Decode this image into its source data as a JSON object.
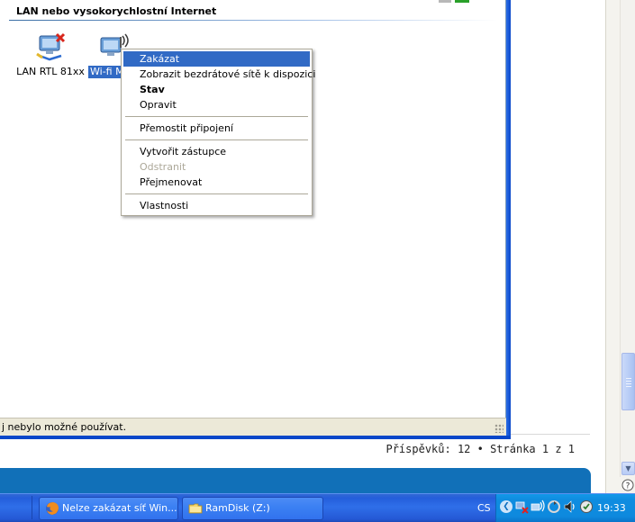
{
  "network_window": {
    "group_header": "LAN nebo vysokorychlostní Internet",
    "connections": [
      {
        "label": "LAN RTL 81xx",
        "icon": "network-disconnected-icon"
      },
      {
        "label": "Wi-fi Mi",
        "icon": "wireless-network-icon",
        "selected": true
      }
    ],
    "status_text": "j nebylo možné používat."
  },
  "context_menu": {
    "items": [
      {
        "label": "Zakázat",
        "state": "highlighted"
      },
      {
        "label": "Zobrazit bezdrátové sítě k dispozici"
      },
      {
        "label": "Stav",
        "state": "bold"
      },
      {
        "label": "Opravit"
      },
      {
        "label": "Přemostit připojení"
      },
      {
        "label": "Vytvořit zástupce"
      },
      {
        "label": "Odstranit",
        "state": "disabled"
      },
      {
        "label": "Přejmenovat"
      },
      {
        "label": "Vlastnosti"
      }
    ]
  },
  "background_page": {
    "post_count": "Příspěvků: 12 • Stránka 1 z 1"
  },
  "taskbar": {
    "buttons": [
      {
        "label": "Nelze zakázat síť Win...",
        "icon": "firefox-icon"
      },
      {
        "label": "RamDisk (Z:)",
        "icon": "folder-icon"
      }
    ],
    "language": "CS",
    "clock": "19:33"
  },
  "colors": {
    "selection": "#316ac5",
    "window_frame": "#0a5ee6",
    "taskbar": "#245edb",
    "tray": "#0f8de0",
    "page_bar": "#1170b8"
  }
}
